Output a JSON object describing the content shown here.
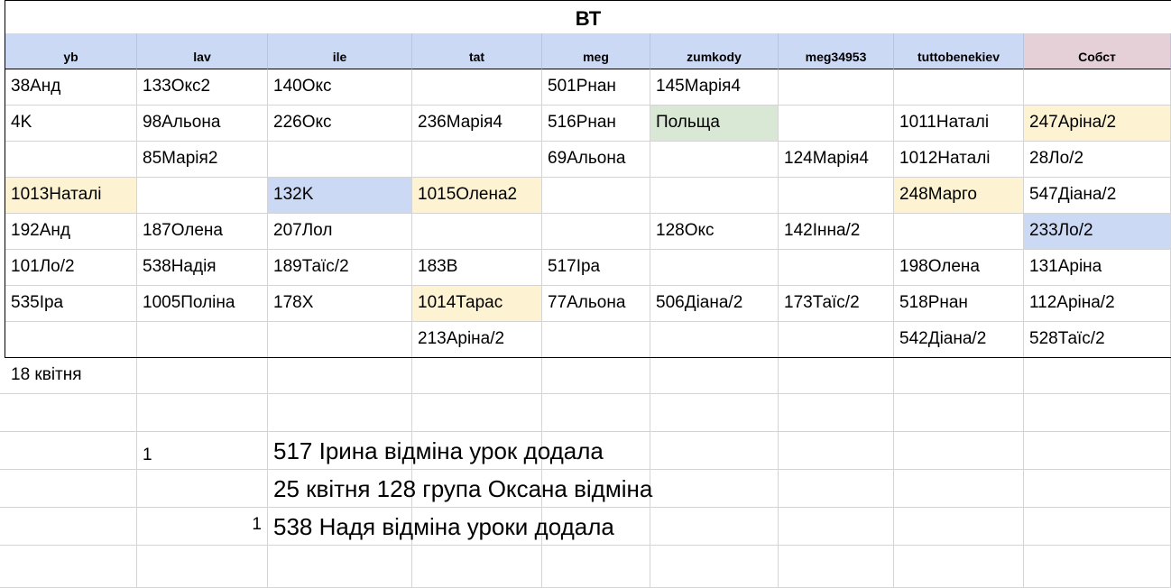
{
  "sheet": {
    "title": "ВТ",
    "headers": [
      "yb",
      "lav",
      "ile",
      "tat",
      "meg",
      "zumkody",
      "meg34953",
      "tuttobenekiev",
      "Собст"
    ],
    "rows": [
      [
        "38Анд",
        "133Окс2",
        "140Окс",
        "",
        "501Рнан",
        "145Марія4",
        "",
        "",
        ""
      ],
      [
        "4K",
        "98Альона",
        "226Окс",
        "236Марія4",
        "516Рнан",
        "Польща",
        "",
        "1011Наталі",
        "247Аріна/2"
      ],
      [
        "",
        "85Марія2",
        "",
        "",
        "69Альона",
        "",
        "124Марія4",
        "1012Наталі",
        "28Ло/2"
      ],
      [
        "1013Наталі",
        "",
        "132K",
        "1015Олена2",
        "",
        "",
        "",
        "248Марго",
        "547Діана/2"
      ],
      [
        "192Анд",
        "187Олена",
        "207Лол",
        "",
        "",
        "128Окс",
        "142Інна/2",
        "",
        "233Ло/2"
      ],
      [
        "101Ло/2",
        "538Надія",
        "189Таїс/2",
        "183В",
        "517Іра",
        "",
        "",
        "198Олена",
        "131Аріна"
      ],
      [
        "535Іра",
        "1005Поліна",
        "178Х",
        "1014Тарас",
        "77Альона",
        "506Діана/2",
        "173Таїс/2",
        "518Рнан",
        "112Аріна/2"
      ],
      [
        "",
        "",
        "",
        "213Аріна/2",
        "",
        "",
        "",
        "542Діана/2",
        "528Таїс/2"
      ]
    ],
    "highlights": {
      "yellow": "#fdf2d1",
      "green": "#d9e8d4",
      "blue": "#ccd9f5",
      "header_blue": "#ccd9f5",
      "header_pink": "#e6d0d8"
    },
    "date": "18 квітня",
    "notes": [
      {
        "num": "1",
        "text": "517 Ірина відміна урок додала"
      },
      {
        "num": "",
        "text": "25 квітня 128 група Оксана відміна"
      },
      {
        "num": "1",
        "text": "538 Надя відміна уроки додала"
      }
    ]
  }
}
